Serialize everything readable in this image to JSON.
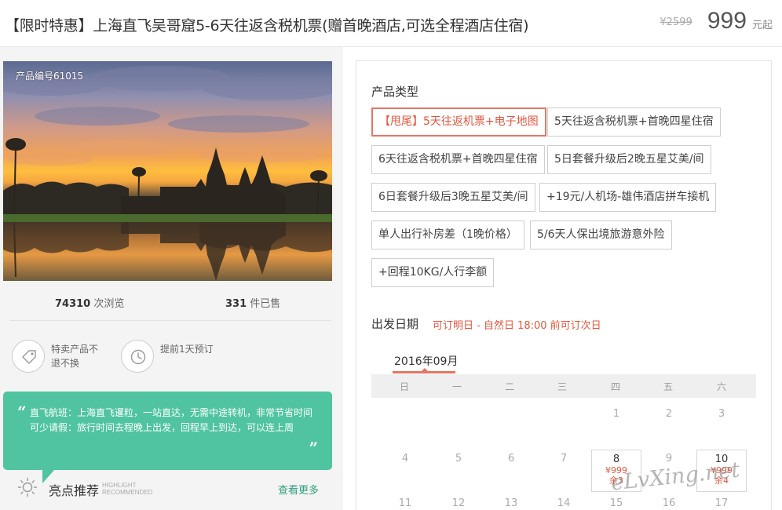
{
  "header": {
    "title": "【限时特惠】上海直飞吴哥窟5-6天往返含税机票(赠首晚酒店,可选全程酒店住宿)",
    "price_original": "¥2599",
    "price_current": "999",
    "price_unit": "元起"
  },
  "gallery": {
    "product_code": "产品编号61015"
  },
  "stats": {
    "views_count": "74310",
    "views_label": "次浏览",
    "sold_count": "331",
    "sold_label": "件已售"
  },
  "features": [
    {
      "icon": "tag-icon",
      "label": "特卖产品不退不换"
    },
    {
      "icon": "clock-icon",
      "label": "提前1天预订"
    }
  ],
  "highlight": {
    "line1": "直飞航班：上海直飞暹粒，一站直达，无需中途转机，非常节省时间",
    "line2": "可少请假：旅行时间去程晚上出发，回程早上到达，可以连上周",
    "title": "亮点推荐",
    "sub_line1": "HIGHLIGHT",
    "sub_line2": "RECOMMENDED",
    "more_link": "查看更多"
  },
  "product_type": {
    "title": "产品类型",
    "options": [
      {
        "label": "【甩尾】5天往返机票+电子地图",
        "selected": true
      },
      {
        "label": "5天往返含税机票+首晚四星住宿",
        "selected": false
      },
      {
        "label": "6天往返含税机票+首晚四星住宿",
        "selected": false
      },
      {
        "label": "5日套餐升级后2晚五星艾美/间",
        "selected": false
      },
      {
        "label": "6日套餐升级后3晚五星艾美/间",
        "selected": false
      },
      {
        "label": "+19元/人机场-雄伟酒店拼车接机",
        "selected": false
      },
      {
        "label": "单人出行补房差（1晚价格）",
        "selected": false
      },
      {
        "label": "5/6天人保出境旅游意外险",
        "selected": false
      },
      {
        "label": "+回程10KG/人行李额",
        "selected": false
      }
    ]
  },
  "departure": {
    "title": "出发日期",
    "hint": "可订明日 - 自然日 18:00 前可订次日",
    "month": "2016年09月",
    "weekdays": [
      "日",
      "一",
      "二",
      "三",
      "四",
      "五",
      "六"
    ],
    "week1": [
      "1",
      "2",
      "3"
    ],
    "week2_plain": [
      "4",
      "5",
      "6",
      "7",
      "9"
    ],
    "week3": [
      "11",
      "12",
      "13",
      "14",
      "15",
      "16",
      "17"
    ],
    "available": [
      {
        "day": "8",
        "price": "¥999",
        "left": "余3"
      },
      {
        "day": "10",
        "price": "¥999",
        "left": "余4"
      }
    ]
  },
  "watermark": "eLvXing.net",
  "colors": {
    "accent": "#e67463",
    "highlight_bg": "#50c4a1",
    "more_link": "#2f9e7e"
  }
}
